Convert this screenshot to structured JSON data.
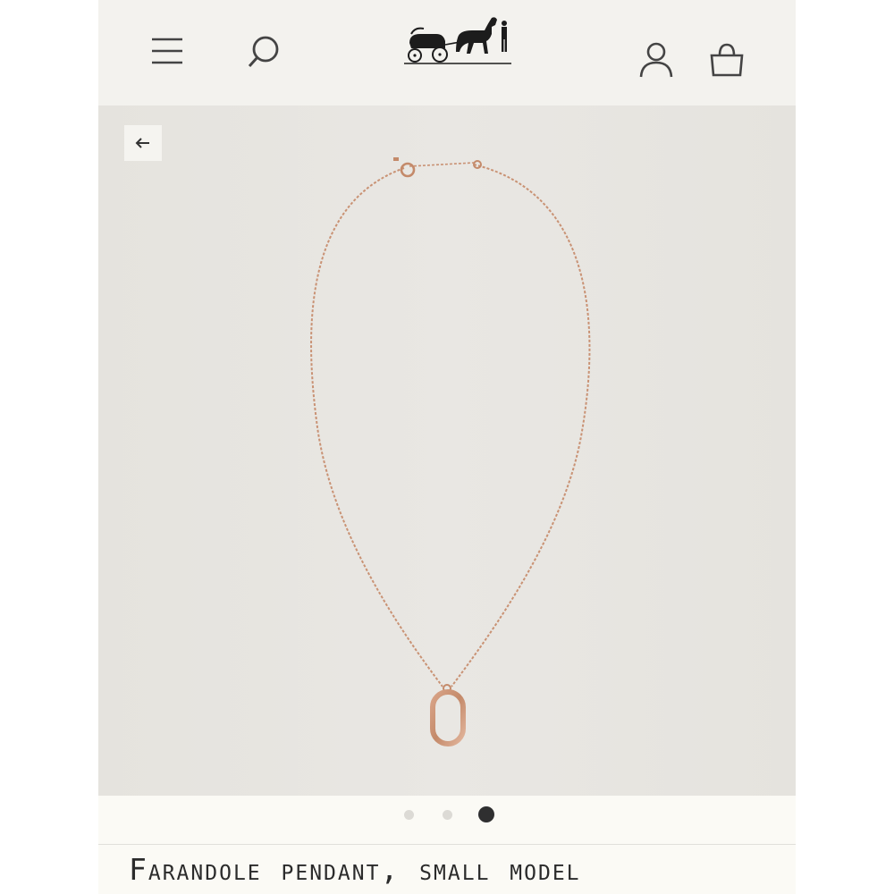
{
  "header": {
    "icons": {
      "menu": "menu-icon",
      "search": "search-icon",
      "logo": "horse-carriage-logo",
      "account": "account-icon",
      "bag": "shopping-bag-icon"
    }
  },
  "gallery": {
    "back_icon": "arrow-left-icon",
    "image": "rose gold necklace with oval link pendant",
    "slide_count": 3,
    "active_slide": 3
  },
  "product": {
    "title": "Farandole pendant, small model"
  },
  "colors": {
    "background": "#f3f2ee",
    "gallery": "#e7e5e1",
    "gold": "#c8906f",
    "active_dot": "#2f2f30",
    "inactive_dot": "#dcdad5",
    "text": "#2b2b2b"
  }
}
